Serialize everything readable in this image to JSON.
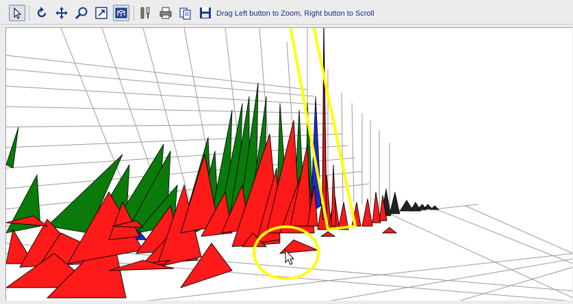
{
  "toolbar": {
    "hint_text": "Drag Left button to Zoom, Right button to Scroll",
    "buttons": [
      {
        "name": "select-button",
        "icon": "pointer-icon",
        "active": true
      },
      {
        "name": "rotate-button",
        "icon": "rotate-icon",
        "active": false
      },
      {
        "name": "pan-button",
        "icon": "move-arrows-icon",
        "active": false
      },
      {
        "name": "zoom-button",
        "icon": "magnifier-icon",
        "active": false
      },
      {
        "name": "zoom-box-button",
        "icon": "zoom-box-icon",
        "active": false
      },
      {
        "name": "view-3d-button",
        "icon": "3d-view-icon",
        "active": true
      },
      {
        "name": "settings-button",
        "icon": "tools-icon",
        "active": false
      },
      {
        "name": "print-button",
        "icon": "printer-icon",
        "active": false
      },
      {
        "name": "copy-button",
        "icon": "copy-icon",
        "active": false
      },
      {
        "name": "save-button",
        "icon": "floppy-disk-icon",
        "active": false
      }
    ]
  },
  "plot": {
    "colors": {
      "red_peak": "#ff1a1a",
      "green_peak": "#0a7a0a",
      "blue_peak": "#1a2acc",
      "grid": "#9a9a9a",
      "highlight": "#ffff00",
      "outline": "#000000"
    },
    "annotations": [
      "highlight-rectangle",
      "highlight-ellipse"
    ]
  }
}
